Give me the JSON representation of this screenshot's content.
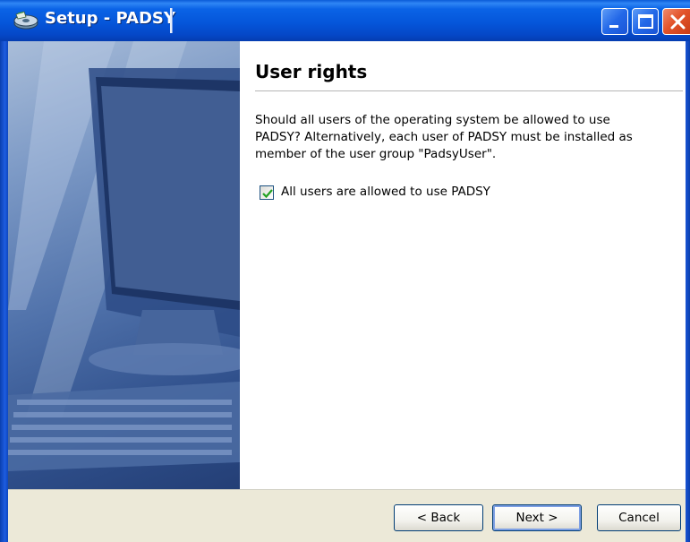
{
  "window": {
    "title": "Setup - PADSY",
    "title_icon": "setup-disk-icon",
    "controls": [
      "minimize-icon",
      "maximize-icon",
      "close-icon"
    ]
  },
  "page": {
    "heading": "User rights",
    "description_lines": [
      "Should all users of the operating system be allowed to use",
      "PADSY? Alternatively, each user of PADSY must be installed as",
      "member of the user group \"PadsyUser\"."
    ],
    "checkbox": {
      "label": "All users are allowed to use PADSY",
      "checked": true
    }
  },
  "buttons": {
    "back": "< Back",
    "next": "Next >",
    "cancel": "Cancel"
  },
  "colors": {
    "titlebar": "#0556da",
    "panel": "#ece9d8",
    "check": "#21a121"
  }
}
